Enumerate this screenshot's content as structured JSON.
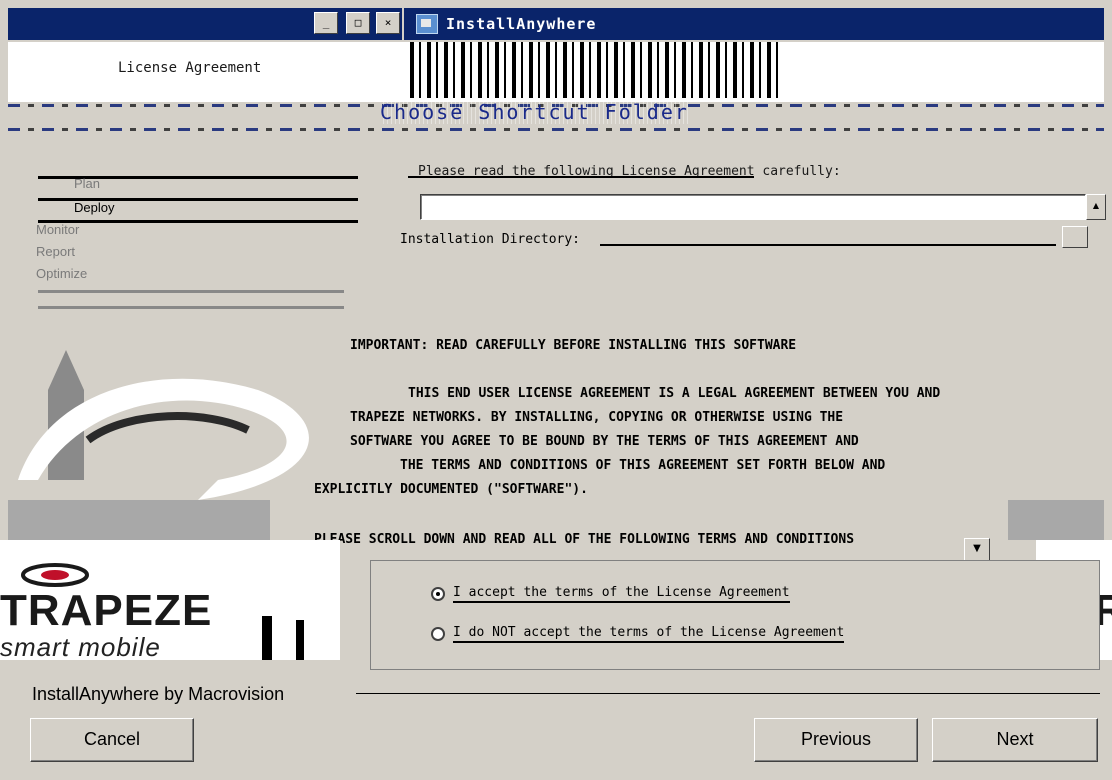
{
  "window": {
    "title": "InstallAnywhere",
    "header_title": "License Agreement",
    "section_title": "Choose Shortcut Folder",
    "controls": [
      "_",
      "□",
      "×"
    ]
  },
  "steps": [
    {
      "label": "Plan"
    },
    {
      "label": "Deploy",
      "current": true
    },
    {
      "label": "Monitor"
    },
    {
      "label": "Report"
    },
    {
      "label": "Optimize"
    }
  ],
  "content": {
    "prompt": "Please read the following License Agreement carefully:",
    "field_label": "Installation Directory:",
    "license_lines": [
      "IMPORTANT: READ CAREFULLY BEFORE INSTALLING THIS SOFTWARE",
      "THIS END USER LICENSE AGREEMENT IS A LEGAL AGREEMENT BETWEEN YOU AND",
      "TRAPEZE NETWORKS. BY INSTALLING, COPYING OR OTHERWISE USING THE",
      "SOFTWARE YOU AGREE TO BE BOUND BY THE TERMS OF THIS AGREEMENT AND",
      "THE TERMS AND CONDITIONS OF THIS AGREEMENT SET FORTH BELOW AND",
      "EXPLICITLY DOCUMENTED (\"SOFTWARE\").",
      "PLEASE SCROLL DOWN AND READ ALL OF THE FOLLOWING TERMS AND CONDITIONS"
    ]
  },
  "radio": {
    "accept": "I accept the terms of the License Agreement",
    "decline": "I do NOT accept the terms of the License Agreement",
    "selected": "accept"
  },
  "branding": {
    "logo_word": "TRAPEZE",
    "logo_sub": "smart mobile",
    "logo_right_word": "TR",
    "installer": "InstallAnywhere by Macrovision"
  },
  "buttons": {
    "cancel": "Cancel",
    "previous": "Previous",
    "next": "Next"
  },
  "colors": {
    "titlebar": "#0a246a",
    "face": "#d4d0c8"
  }
}
